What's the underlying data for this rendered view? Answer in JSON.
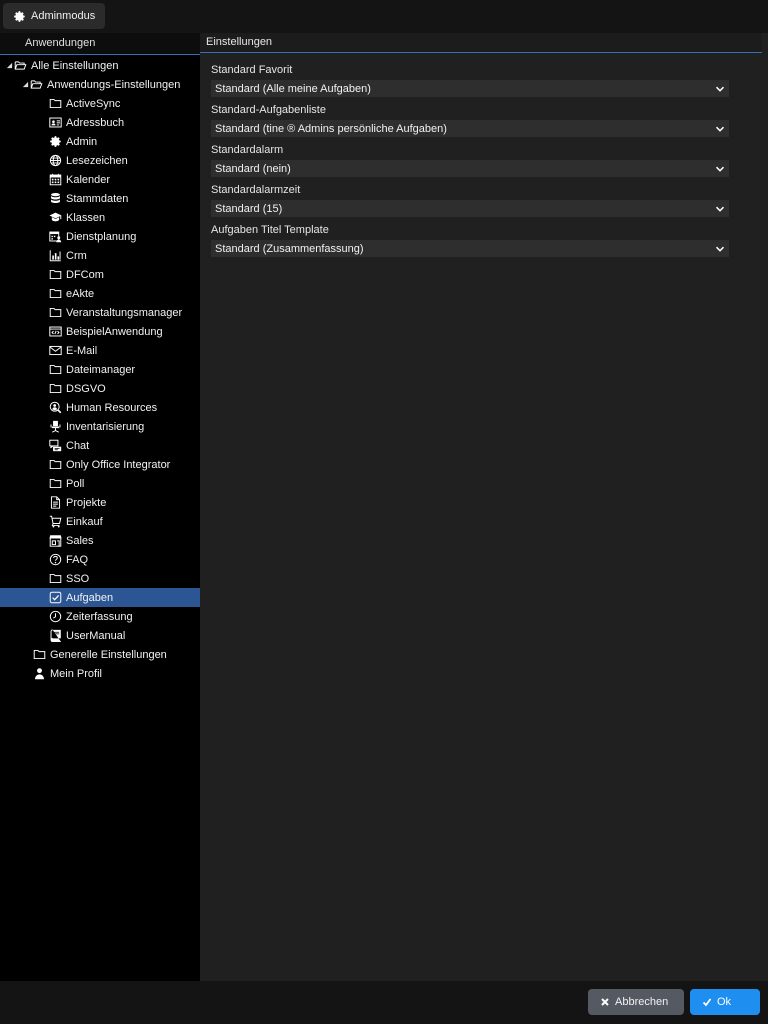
{
  "toolbar": {
    "admin_mode_label": "Adminmodus"
  },
  "left_panel": {
    "header": "Anwendungen",
    "tree": {
      "root": "Alle Einstellungen",
      "app_settings": "Anwendungs-Einstellungen",
      "apps": [
        {
          "label": "ActiveSync",
          "icon": "folder-icon"
        },
        {
          "label": "Adressbuch",
          "icon": "address-card-icon"
        },
        {
          "label": "Admin",
          "icon": "gear-icon"
        },
        {
          "label": "Lesezeichen",
          "icon": "globe-icon"
        },
        {
          "label": "Kalender",
          "icon": "calendar-icon"
        },
        {
          "label": "Stammdaten",
          "icon": "database-icon"
        },
        {
          "label": "Klassen",
          "icon": "graduation-cap-icon"
        },
        {
          "label": "Dienstplanung",
          "icon": "calendar-user-icon"
        },
        {
          "label": "Crm",
          "icon": "bar-chart-icon"
        },
        {
          "label": "DFCom",
          "icon": "folder-icon"
        },
        {
          "label": "eAkte",
          "icon": "folder-icon"
        },
        {
          "label": "Veranstaltungsmanager",
          "icon": "folder-icon"
        },
        {
          "label": "BeispielAnwendung",
          "icon": "code-window-icon"
        },
        {
          "label": "E-Mail",
          "icon": "envelope-icon"
        },
        {
          "label": "Dateimanager",
          "icon": "folder-icon"
        },
        {
          "label": "DSGVO",
          "icon": "folder-icon"
        },
        {
          "label": "Human Resources",
          "icon": "user-search-icon"
        },
        {
          "label": "Inventarisierung",
          "icon": "office-chair-icon"
        },
        {
          "label": "Chat",
          "icon": "chat-icon"
        },
        {
          "label": "Only Office Integrator",
          "icon": "folder-icon"
        },
        {
          "label": "Poll",
          "icon": "folder-icon"
        },
        {
          "label": "Projekte",
          "icon": "document-icon"
        },
        {
          "label": "Einkauf",
          "icon": "cart-icon"
        },
        {
          "label": "Sales",
          "icon": "store-icon"
        },
        {
          "label": "FAQ",
          "icon": "question-circle-icon"
        },
        {
          "label": "SSO",
          "icon": "folder-icon"
        },
        {
          "label": "Aufgaben",
          "icon": "check-square-icon",
          "selected": true
        },
        {
          "label": "Zeiterfassung",
          "icon": "clock-icon"
        },
        {
          "label": "UserManual",
          "icon": "book-icon"
        }
      ],
      "general_settings": "Generelle Einstellungen",
      "my_profile": "Mein Profil"
    }
  },
  "right_panel": {
    "header": "Einstellungen",
    "fields": [
      {
        "label": "Standard Favorit",
        "value": "Standard (Alle meine Aufgaben)"
      },
      {
        "label": "Standard-Aufgabenliste",
        "value": "Standard (tine ® Admins persönliche Aufgaben)"
      },
      {
        "label": "Standardalarm",
        "value": "Standard (nein)"
      },
      {
        "label": "Standardalarmzeit",
        "value": "Standard (15)"
      },
      {
        "label": "Aufgaben Titel Template",
        "value": "Standard (Zusammenfassung)"
      }
    ]
  },
  "footer": {
    "cancel_label": "Abbrechen",
    "ok_label": "Ok"
  },
  "colors": {
    "selection": "#2c5594",
    "ok_button": "#1f8ef1",
    "cancel_button": "#555a62",
    "header_rule": "#3b6db3"
  }
}
